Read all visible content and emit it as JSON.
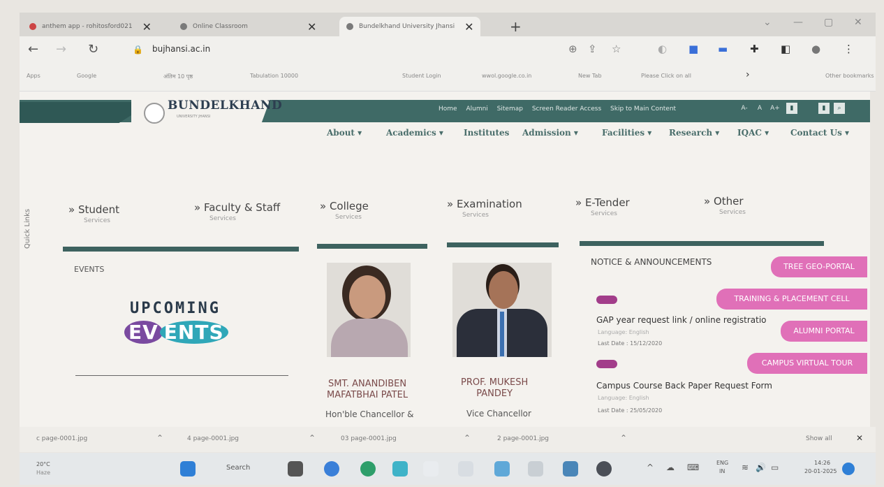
{
  "browser": {
    "tabs": [
      {
        "label": "anthem app - rohitosford021"
      },
      {
        "label": "Online Classroom"
      },
      {
        "label": "Bundelkhand University Jhansi"
      }
    ],
    "url": "bujhansi.ac.in",
    "bookmarks": [
      "Apps",
      "Google",
      "अंतिम 10 पृष्ठ",
      "Tabulation 10000",
      "Student Login",
      "wwol.google.co.in",
      "New Tab",
      "Please Click on all"
    ],
    "bookmarks_more": "Other bookmarks"
  },
  "site": {
    "logo_name": "BUNDELKHAND",
    "logo_sub": "UNIVERSITY JHANSI",
    "top_links": [
      "Home",
      "Alumni",
      "Sitemap",
      "Screen Reader Access",
      "Skip to Main Content"
    ],
    "font_controls": [
      "A-",
      "A",
      "A+"
    ],
    "menu": [
      "About ▾",
      "Academics ▾",
      "Institutes",
      "Admission ▾",
      "Facilities ▾",
      "Research ▾",
      "IQAC ▾",
      "Contact Us ▾"
    ],
    "quick_links": "Quick Links",
    "services": [
      {
        "title": "» Student",
        "sub": "Services"
      },
      {
        "title": "» Faculty & Staff",
        "sub": "Services"
      },
      {
        "title": "» College",
        "sub": "Services"
      },
      {
        "title": "» Examination",
        "sub": "Services"
      },
      {
        "title": "» E-Tender",
        "sub": "Services"
      },
      {
        "title": "» Other",
        "sub": "Services"
      }
    ],
    "events_heading": "EVENTS",
    "upcoming_line1": "UPCOMING",
    "upcoming_line2a": "EV",
    "upcoming_line2b": "ENTS",
    "people": [
      {
        "name1": "SMT. ANANDIBEN",
        "name2": "MAFATBHAI PATEL",
        "role": "Hon'ble Chancellor &"
      },
      {
        "name1": "PROF. MUKESH",
        "name2": "PANDEY",
        "role": "Vice Chancellor"
      }
    ],
    "notice_heading": "NOTICE & ANNOUNCEMENTS",
    "notices": [
      {
        "title": "GAP year request link / online registratio",
        "lang": "Language: English",
        "date": "Last Date : 15/12/2020"
      },
      {
        "title": "Campus Course Back Paper Request Form",
        "lang": "Language: English",
        "date": "Last Date : 25/05/2020"
      }
    ],
    "side_buttons": [
      "TREE GEO-PORTAL",
      "TRAINING & PLACEMENT CELL",
      "ALUMNI PORTAL",
      "CAMPUS VIRTUAL TOUR"
    ]
  },
  "downloads": {
    "items": [
      "c page-0001.jpg",
      "4 page-0001.jpg",
      "03 page-0001.jpg",
      "2 page-0001.jpg"
    ],
    "show_all": "Show all"
  },
  "taskbar": {
    "weather_temp": "20°C",
    "weather_text": "Haze",
    "search": "Search",
    "lang": "ENG",
    "lang2": "IN",
    "time": "14:26",
    "date": "20-01-2025"
  }
}
